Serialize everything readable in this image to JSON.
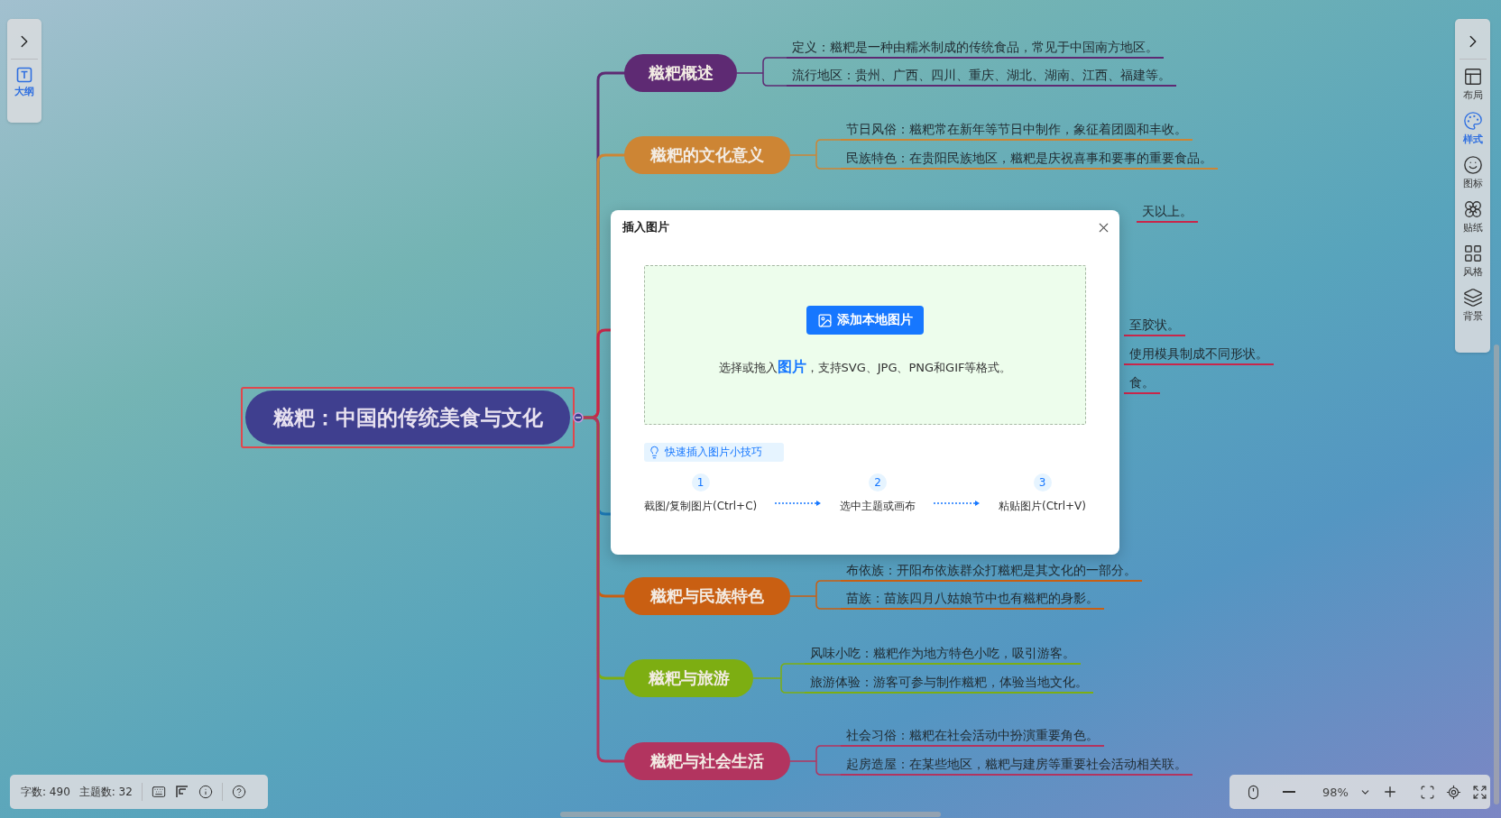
{
  "left_panel": {
    "items": [
      {
        "label": "大纲",
        "selected": true
      }
    ]
  },
  "mind_map": {
    "root": {
      "text": "糍粑：中国的传统美食与文化",
      "selected": true
    },
    "branches": [
      {
        "text": "糍粑概述",
        "color": "#5e2a73",
        "leaves": [
          {
            "text": "定义：糍粑是一种由糯米制成的传统食品，常见于中国南方地区。"
          },
          {
            "text": "流行地区：贵州、广西、四川、重庆、湖北、湖南、江西、福建等。"
          }
        ]
      },
      {
        "text": "糍粑的文化意义",
        "color": "#cd8534",
        "leaves": [
          {
            "text": "节日风俗：糍粑常在新年等节日中制作，象征着团圆和丰收。"
          },
          {
            "text": "民族特色：在贵阳民族地区，糍粑是庆祝喜事和要事的重要食品。"
          }
        ]
      },
      {
        "color": "#c9264a",
        "leaves": [
          {
            "text": "天以上。"
          },
          {
            "text": "至胶状。"
          },
          {
            "text": "使用模具制成不同形状。"
          },
          {
            "text": "食。"
          }
        ]
      },
      {
        "color": "#1b78b5"
      },
      {
        "text": "糍粑与民族特色",
        "color": "#c95f12",
        "leaves": [
          {
            "text": "布依族：开阳布依族群众打糍粑是其文化的一部分。"
          },
          {
            "text": "苗族：苗族四月八姑娘节中也有糍粑的身影。"
          }
        ]
      },
      {
        "text": "糍粑与旅游",
        "color": "#7dae12",
        "leaves": [
          {
            "text": "风味小吃：糍粑作为地方特色小吃，吸引游客。"
          },
          {
            "text": "旅游体验：游客可参与制作糍粑，体验当地文化。"
          }
        ]
      },
      {
        "text": "糍粑与社会生活",
        "color": "#b2345f",
        "leaves": [
          {
            "text": "社会习俗：糍粑在社会活动中扮演重要角色。"
          },
          {
            "text": "起房造屋：在某些地区，糍粑与建房等重要社会活动相关联。"
          }
        ]
      }
    ]
  },
  "dialog": {
    "title": "插入图片",
    "upload_button": "添加本地图片",
    "hint": "选择或拖入**图片**，支持SVG、JPG、PNG和GIF等格式。",
    "tip": "快速插入图片小技巧",
    "steps": [
      {
        "number": "1",
        "label": "截图/复制图片(Ctrl+C)"
      },
      {
        "number": "2",
        "label": "选中主题或画布"
      },
      {
        "number": "3",
        "label": "粘贴图片(Ctrl+V)"
      }
    ]
  },
  "right_panel": {
    "items": [
      {
        "kind": "layout",
        "label": "布局",
        "selected": false
      },
      {
        "kind": "style",
        "label": "样式",
        "selected": true
      },
      {
        "kind": "icon",
        "label": "图标",
        "selected": false
      },
      {
        "kind": "sticker",
        "label": "贴纸",
        "selected": false
      },
      {
        "kind": "theme",
        "label": "风格",
        "selected": false
      },
      {
        "kind": "background",
        "label": "背景",
        "selected": false
      }
    ]
  },
  "status_bar": {
    "word_count": "字数: 490",
    "topic_count": "主题数: 32"
  },
  "zoom_bar": {
    "value": "98%"
  }
}
